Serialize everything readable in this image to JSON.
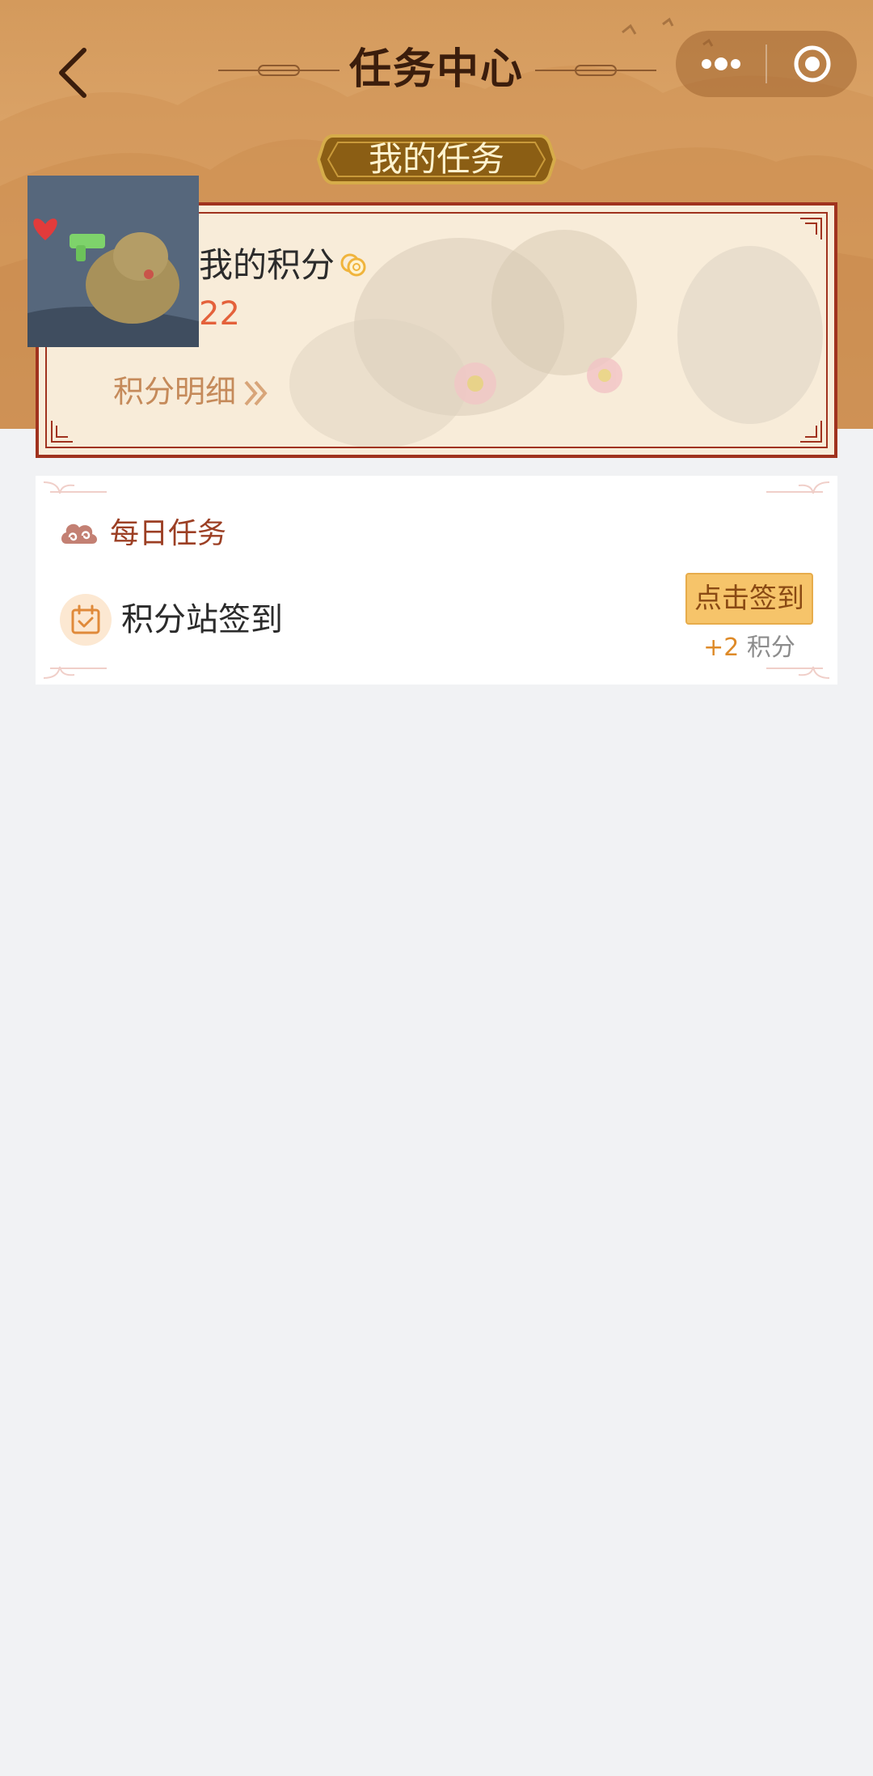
{
  "nav": {
    "title": "任务中心",
    "back_icon": "chevron-left-icon",
    "more_icon": "more-dots-icon",
    "close_icon": "target-close-icon"
  },
  "banner": {
    "label": "我的任务"
  },
  "points_card": {
    "title": "我的积分",
    "value": "22",
    "detail_link": "积分明细",
    "coin_icon": "coin-icon",
    "avatar_alt": "avatar"
  },
  "daily_tasks": {
    "section_title": "每日任务",
    "section_icon": "cloud-swirl-icon",
    "items": [
      {
        "icon": "calendar-check-icon",
        "label": "积分站签到",
        "button": "点击签到",
        "reward_amount": "+2",
        "reward_unit": "积分"
      }
    ]
  },
  "colors": {
    "header_bg": "#d49a5c",
    "page_bg": "#f1f2f4",
    "card_border": "#a0321e",
    "accent_orange": "#e4613b",
    "button_bg": "#f6c46a"
  }
}
